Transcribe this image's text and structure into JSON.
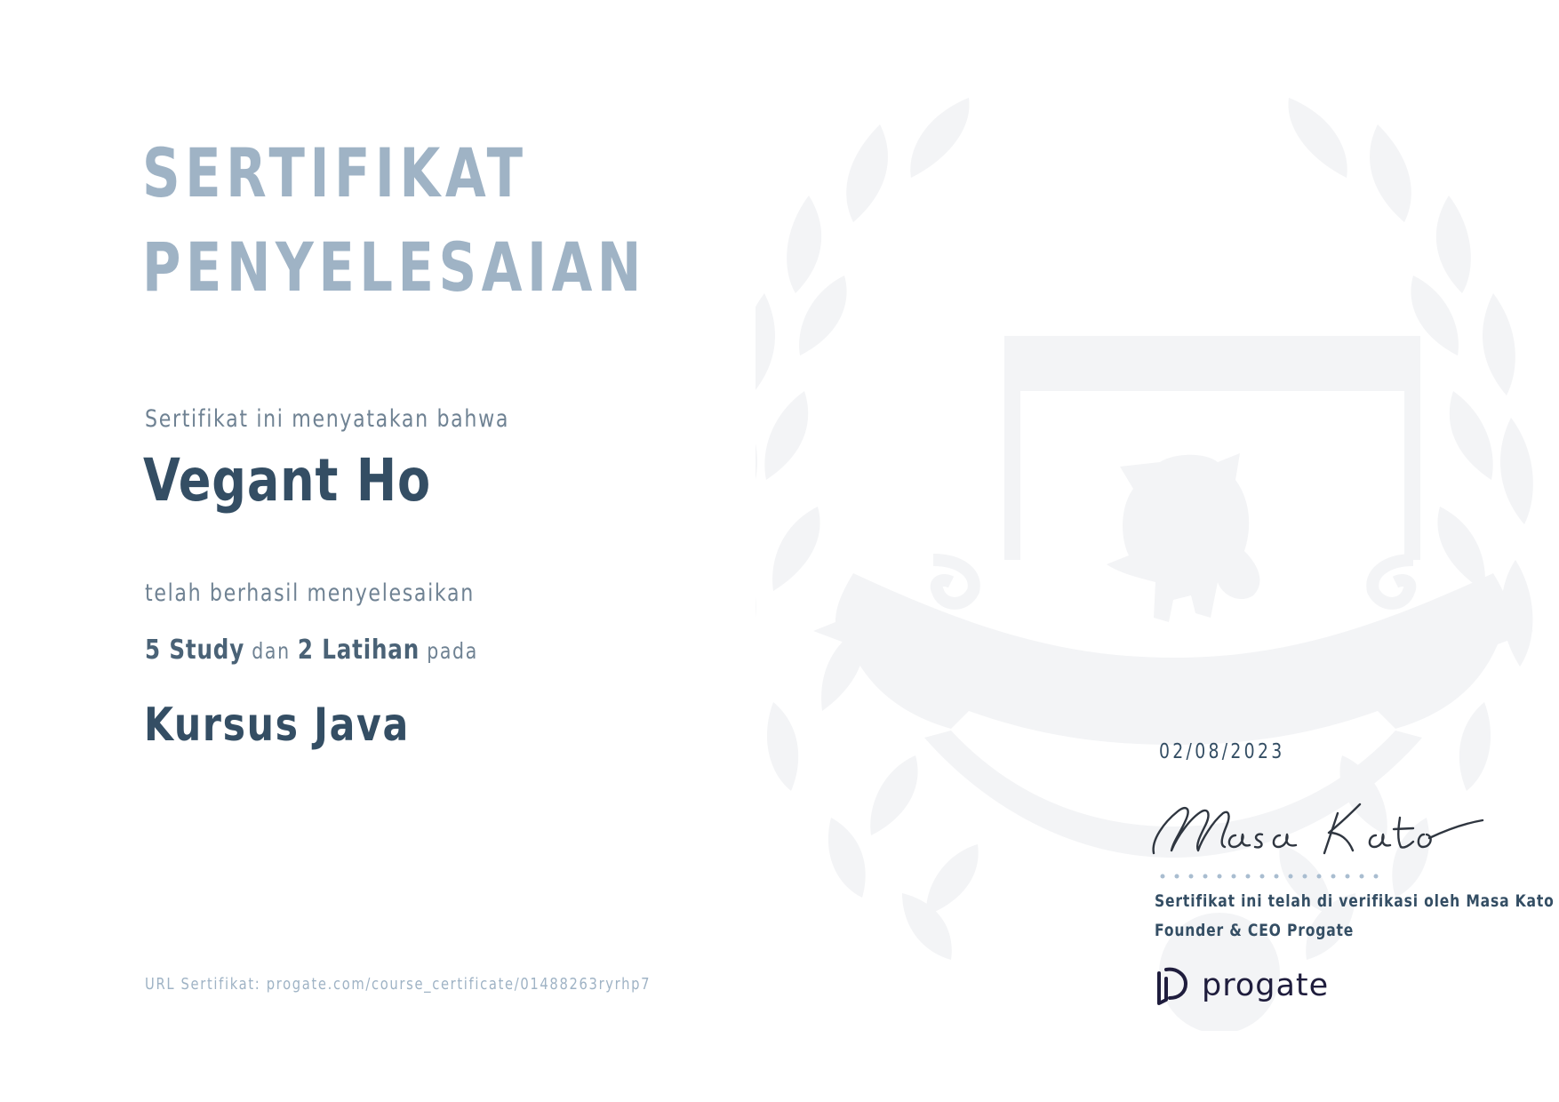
{
  "certificate": {
    "title_line1": "SERTIFIKAT",
    "title_line2": "PENYELESAIAN",
    "intro": "Sertifikat ini menyatakan bahwa",
    "recipient": "Vegant Ho",
    "completed": "telah berhasil menyelesaikan",
    "study_count": "5 Study",
    "and_word": "dan",
    "exercise_count": "2 Latihan",
    "on_word": "pada",
    "course": "Kursus Java",
    "url": "URL Sertifikat: progate.com/course_certificate/01488263ryrhp7"
  },
  "issuer": {
    "date": "02/08/2023",
    "signature_text": "Masa Kato",
    "verified_by": "Sertifikat ini telah di verifikasi oleh Masa Kato",
    "role": "Founder & CEO Progate",
    "brand": "progate"
  },
  "colors": {
    "title": "#9fb3c5",
    "heading": "#344e64",
    "body": "#6f8293",
    "watermark": "#f3f4f6",
    "dots": "#a9bdd0",
    "brand": "#1f1d3d"
  },
  "icons": {
    "watermark": "laurel-crest-icon",
    "logo": "progate-logo-icon"
  }
}
